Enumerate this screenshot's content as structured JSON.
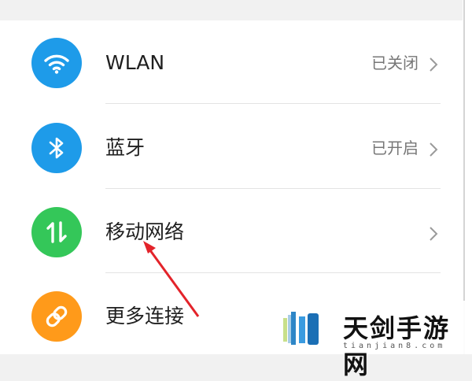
{
  "colors": {
    "wlan_icon_bg": "#1e9be9",
    "bluetooth_icon_bg": "#1e9be9",
    "mobile_network_icon_bg": "#34c759",
    "more_connections_icon_bg": "#ff9a1a",
    "annotation_arrow": "#e3232a"
  },
  "settings": {
    "rows": [
      {
        "label": "WLAN",
        "value": "已关闭",
        "icon": "wifi-icon"
      },
      {
        "label": "蓝牙",
        "value": "已开启",
        "icon": "bluetooth-icon"
      },
      {
        "label": "移动网络",
        "value": "",
        "icon": "mobile-data-icon"
      },
      {
        "label": "更多连接",
        "value": "",
        "icon": "link-icon"
      }
    ]
  },
  "watermark": {
    "name": "天剑手游网",
    "domain": "tianjian8.com"
  }
}
